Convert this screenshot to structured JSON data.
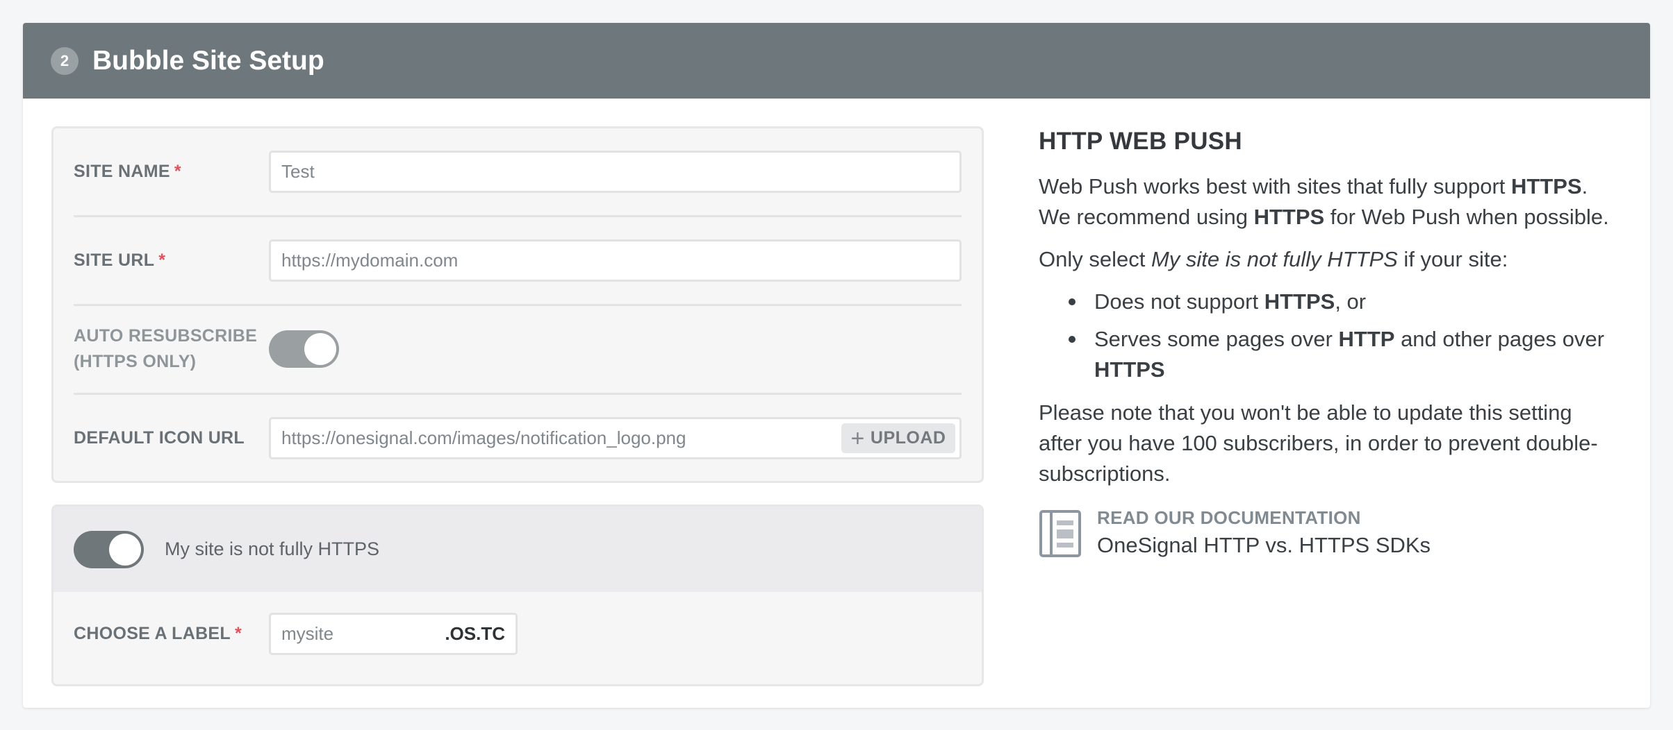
{
  "header": {
    "step_number": "2",
    "title": "Bubble Site Setup"
  },
  "form": {
    "site_name": {
      "label": "SITE NAME",
      "required_mark": "*",
      "value": "Test"
    },
    "site_url": {
      "label": "SITE URL",
      "required_mark": "*",
      "placeholder": "https://mydomain.com"
    },
    "auto_resubscribe": {
      "label_line1": "AUTO RESUBSCRIBE",
      "label_line2": "(HTTPS ONLY)",
      "enabled": true
    },
    "default_icon_url": {
      "label": "DEFAULT ICON URL",
      "value": "https://onesignal.com/images/notification_logo.png",
      "upload_label": "UPLOAD",
      "upload_icon": "plus-icon"
    }
  },
  "https_panel": {
    "toggle_label": "My site is not fully HTTPS",
    "toggle_enabled": true,
    "choose_label": {
      "label": "CHOOSE A LABEL",
      "required_mark": "*",
      "value": "mysite",
      "suffix": ".OS.TC"
    }
  },
  "info": {
    "title": "HTTP WEB PUSH",
    "p1": {
      "a": "Web Push works best with sites that fully support ",
      "b": "HTTPS",
      "c": ". We recommend using ",
      "d": "HTTPS",
      "e": " for Web Push when possible."
    },
    "p2": {
      "a": "Only select ",
      "b": "My site is not fully HTTPS",
      "c": " if your site:"
    },
    "bullets": [
      {
        "a": "Does not support ",
        "b": "HTTPS",
        "c": ", or"
      },
      {
        "a": "Serves some pages over ",
        "b": "HTTP",
        "c": " and other pages over ",
        "d": "HTTPS"
      }
    ],
    "p3": "Please note that you won't be able to update this setting after you have 100 subscribers, in order to prevent double-subscriptions.",
    "doc": {
      "kicker": "READ OUR DOCUMENTATION",
      "link": "OneSignal HTTP vs. HTTPS SDKs",
      "icon": "document-icon"
    }
  },
  "colors": {
    "header_bg": "#6e777b",
    "required": "#e2505a",
    "toggle_on": "#9a9fa2",
    "toggle_dark": "#6f777a"
  }
}
